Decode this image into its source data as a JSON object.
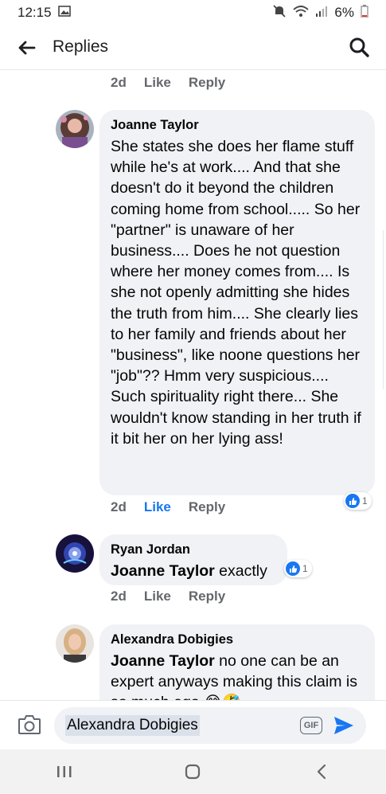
{
  "status_bar": {
    "time": "12:15",
    "battery": "6%",
    "icons": [
      "gallery-icon",
      "mute-icon",
      "wifi-icon",
      "signal-icon",
      "battery-icon"
    ]
  },
  "nav": {
    "title": "Replies",
    "back_icon": "arrow-left-icon",
    "search_icon": "search-icon"
  },
  "colors": {
    "accent": "#1877f2",
    "bubble": "#f0f2f5",
    "secondary_text": "#65676b"
  },
  "top_actions": {
    "time": "2d",
    "like": "Like",
    "reply": "Reply"
  },
  "comments": [
    {
      "author": "Joanne Taylor",
      "text": "She states she does her flame stuff while he's at work.... And that she doesn't do it beyond the children coming home from school..... So her \"partner\" is unaware of her business.... Does he not question where her money comes from.... Is she not openly admitting she hides the truth from him.... She clearly lies to her family and friends about her \"business\", like noone questions her \"job\"??  Hmm very suspicious.... Such spirituality right there... She wouldn't know standing in her truth if it bit her on her lying ass!",
      "time": "2d",
      "like": "Like",
      "reply": "Reply",
      "reaction_count": "1"
    },
    {
      "author": "Ryan Jordan",
      "mention": "Joanne Taylor",
      "text": " exactly",
      "time": "2d",
      "like": "Like",
      "reply": "Reply",
      "reaction_count": "1"
    },
    {
      "author": "Alexandra Dobigies",
      "mention": "Joanne Taylor",
      "text": " no one can be an expert anyways making this claim is so much ego 😂🤣"
    }
  ],
  "composer": {
    "value": "Alexandra Dobigies",
    "gif_label": "GIF",
    "camera_icon": "camera-icon",
    "send_icon": "send-icon"
  },
  "system_nav": [
    "recents-icon",
    "home-icon",
    "back-icon"
  ]
}
